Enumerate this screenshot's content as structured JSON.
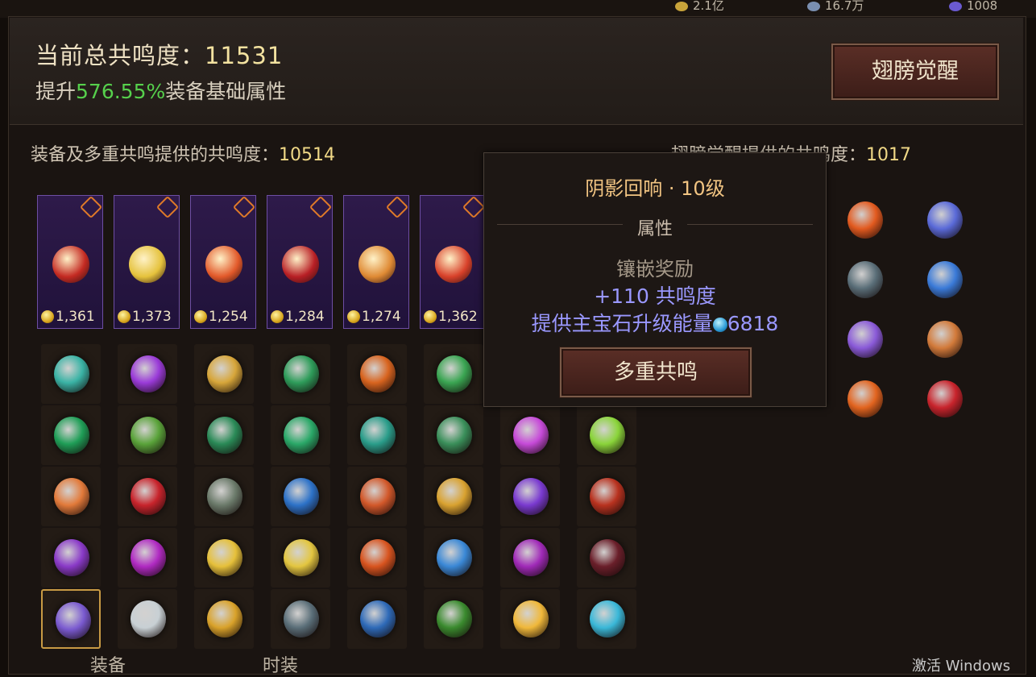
{
  "top": {
    "res1": "2.1亿",
    "res2": "16.7万",
    "res3": "1008"
  },
  "header": {
    "total_label": "当前总共鸣度：",
    "total_value": "11531",
    "boost_prefix": "提升",
    "boost_pct": "576.55%",
    "boost_suffix": "装备基础属性",
    "awaken_button": "翅膀觉醒"
  },
  "subtotals": {
    "equip_label": "装备及多重共鸣提供的共鸣度：",
    "equip_value": "10514",
    "wing_label": "翅膀觉醒提供的共鸣度：",
    "wing_value": "1017"
  },
  "tooltip": {
    "title": "阴影回响 · 10级",
    "attr_header": "属性",
    "reward_label": "镶嵌奖励",
    "reward_value": "+110 共鸣度",
    "energy_label": "提供主宝石升级能量",
    "energy_value": "6818",
    "button": "多重共鸣"
  },
  "equipment": [
    {
      "score": "1,361",
      "color": "#c42a22"
    },
    {
      "score": "1,373",
      "color": "#e5c23c"
    },
    {
      "score": "1,254",
      "color": "#e2592a"
    },
    {
      "score": "1,284",
      "color": "#b81f25"
    },
    {
      "score": "1,274",
      "color": "#df8a34"
    },
    {
      "score": "1,362",
      "color": "#d8412a"
    }
  ],
  "gems": [
    [
      "#3ab3a5",
      "#9a3bd8",
      "#d7a63a",
      "#2e9c5a",
      "#d8641f",
      "#3aa552"
    ],
    [
      "#1f9e57",
      "#5aa33a",
      "#2a8a57",
      "#2aa868",
      "#2a9d8a",
      "#3a8f5a",
      "#c64ad8",
      "#8ad43a"
    ],
    [
      "#e27a3a",
      "#c8242c",
      "#6b7a6a",
      "#2d72c8",
      "#d2582a",
      "#d9a230",
      "#7a3ad0",
      "#b8321f"
    ],
    [
      "#8a3ac8",
      "#b02ac2",
      "#e6c03a",
      "#e3c640",
      "#d8541f",
      "#3a88d6",
      "#a02ab8",
      "#6a1f2a"
    ],
    [
      "#7a5ad0",
      "#c8d0d4",
      "#d9a22a",
      "#5a6e78",
      "#2e6ab8",
      "#3a8a2e",
      "#f0b83a",
      "#3ab8d8"
    ]
  ],
  "right_gems": [
    "#e25a1f",
    "#5a6ad8",
    "#5a6e78",
    "#3a7ad8",
    "#8a5ad8",
    "#d27a3a",
    "#e2641f",
    "#c8242c"
  ],
  "tabs": {
    "equip": "装备",
    "fashion": "时装"
  },
  "watermark": "激活 Windows"
}
